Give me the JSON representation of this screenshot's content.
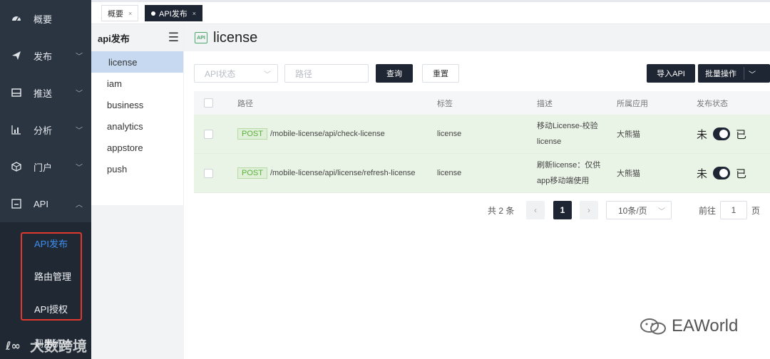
{
  "nav": {
    "items": [
      {
        "label": "概要",
        "icon": "dashboard-icon"
      },
      {
        "label": "发布",
        "icon": "send-icon"
      },
      {
        "label": "推送",
        "icon": "inbox-icon"
      },
      {
        "label": "分析",
        "icon": "chart-icon"
      },
      {
        "label": "门户",
        "icon": "cube-icon"
      },
      {
        "label": "API",
        "icon": "api-icon"
      }
    ],
    "api_sub": [
      "API发布",
      "路由管理",
      "API授权"
    ],
    "last_item": "调用统计"
  },
  "tabs": [
    {
      "label": "概要"
    },
    {
      "label": "API发布"
    }
  ],
  "submenu": {
    "title": "api发布",
    "items": [
      "license",
      "iam",
      "business",
      "analytics",
      "appstore",
      "push"
    ]
  },
  "main": {
    "title": "license",
    "badge": "API",
    "filters": {
      "status_placeholder": "API状态",
      "path_placeholder": "路径",
      "query_label": "查询",
      "reset_label": "重置",
      "import_label": "导入API",
      "batch_label": "批量操作"
    },
    "table": {
      "headers": [
        "路径",
        "标签",
        "描述",
        "所属应用",
        "发布状态"
      ],
      "rows": [
        {
          "method": "POST",
          "path": "/mobile-license/api/check-license",
          "tag": "license",
          "desc": "移动License-校验license",
          "app": "大熊猫",
          "status_left": "未",
          "status_right": "已"
        },
        {
          "method": "POST",
          "path": "/mobile-license/api/license/refresh-license",
          "tag": "license",
          "desc": "刷新license：仅供app移动端使用",
          "app": "大熊猫",
          "status_left": "未",
          "status_right": "已"
        }
      ]
    },
    "pager": {
      "total": "共 2 条",
      "current": "1",
      "page_size": "10条/页",
      "goto_label": "前往",
      "goto_value": "1",
      "page_unit": "页"
    }
  },
  "watermarks": {
    "left": "大数跨境",
    "right": "EAWorld"
  }
}
